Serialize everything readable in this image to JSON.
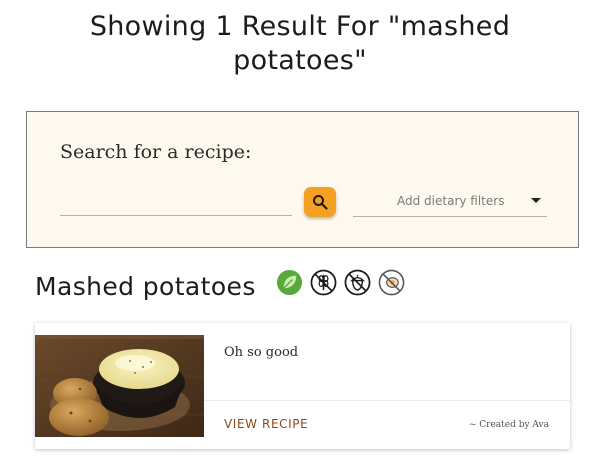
{
  "results_heading": {
    "line1": "Showing 1 Result For \"mashed",
    "line2": "potatoes\""
  },
  "search": {
    "label": "Search for a recipe:",
    "input_value": "",
    "search_icon": "magnifier-icon",
    "filter_placeholder": "Add dietary filters",
    "accent_color": "#f4a020"
  },
  "recipe": {
    "title": "Mashed potatoes",
    "diet_icons": [
      "vegetarian-leaf-icon",
      "gluten-free-icon",
      "nut-free-icon",
      "no-egg-icon"
    ],
    "description": "Oh so good",
    "view_link": "VIEW RECIPE",
    "created_by": "~ Created by Ava"
  }
}
